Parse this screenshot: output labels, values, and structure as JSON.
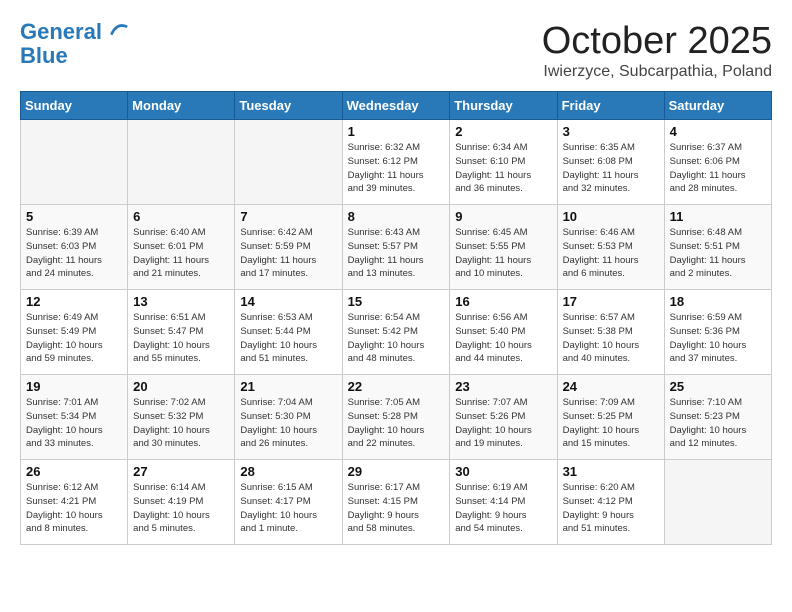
{
  "header": {
    "logo_line1": "General",
    "logo_line2": "Blue",
    "month": "October 2025",
    "location": "Iwierzyce, Subcarpathia, Poland"
  },
  "weekdays": [
    "Sunday",
    "Monday",
    "Tuesday",
    "Wednesday",
    "Thursday",
    "Friday",
    "Saturday"
  ],
  "weeks": [
    [
      {
        "day": "",
        "info": ""
      },
      {
        "day": "",
        "info": ""
      },
      {
        "day": "",
        "info": ""
      },
      {
        "day": "1",
        "info": "Sunrise: 6:32 AM\nSunset: 6:12 PM\nDaylight: 11 hours\nand 39 minutes."
      },
      {
        "day": "2",
        "info": "Sunrise: 6:34 AM\nSunset: 6:10 PM\nDaylight: 11 hours\nand 36 minutes."
      },
      {
        "day": "3",
        "info": "Sunrise: 6:35 AM\nSunset: 6:08 PM\nDaylight: 11 hours\nand 32 minutes."
      },
      {
        "day": "4",
        "info": "Sunrise: 6:37 AM\nSunset: 6:06 PM\nDaylight: 11 hours\nand 28 minutes."
      }
    ],
    [
      {
        "day": "5",
        "info": "Sunrise: 6:39 AM\nSunset: 6:03 PM\nDaylight: 11 hours\nand 24 minutes."
      },
      {
        "day": "6",
        "info": "Sunrise: 6:40 AM\nSunset: 6:01 PM\nDaylight: 11 hours\nand 21 minutes."
      },
      {
        "day": "7",
        "info": "Sunrise: 6:42 AM\nSunset: 5:59 PM\nDaylight: 11 hours\nand 17 minutes."
      },
      {
        "day": "8",
        "info": "Sunrise: 6:43 AM\nSunset: 5:57 PM\nDaylight: 11 hours\nand 13 minutes."
      },
      {
        "day": "9",
        "info": "Sunrise: 6:45 AM\nSunset: 5:55 PM\nDaylight: 11 hours\nand 10 minutes."
      },
      {
        "day": "10",
        "info": "Sunrise: 6:46 AM\nSunset: 5:53 PM\nDaylight: 11 hours\nand 6 minutes."
      },
      {
        "day": "11",
        "info": "Sunrise: 6:48 AM\nSunset: 5:51 PM\nDaylight: 11 hours\nand 2 minutes."
      }
    ],
    [
      {
        "day": "12",
        "info": "Sunrise: 6:49 AM\nSunset: 5:49 PM\nDaylight: 10 hours\nand 59 minutes."
      },
      {
        "day": "13",
        "info": "Sunrise: 6:51 AM\nSunset: 5:47 PM\nDaylight: 10 hours\nand 55 minutes."
      },
      {
        "day": "14",
        "info": "Sunrise: 6:53 AM\nSunset: 5:44 PM\nDaylight: 10 hours\nand 51 minutes."
      },
      {
        "day": "15",
        "info": "Sunrise: 6:54 AM\nSunset: 5:42 PM\nDaylight: 10 hours\nand 48 minutes."
      },
      {
        "day": "16",
        "info": "Sunrise: 6:56 AM\nSunset: 5:40 PM\nDaylight: 10 hours\nand 44 minutes."
      },
      {
        "day": "17",
        "info": "Sunrise: 6:57 AM\nSunset: 5:38 PM\nDaylight: 10 hours\nand 40 minutes."
      },
      {
        "day": "18",
        "info": "Sunrise: 6:59 AM\nSunset: 5:36 PM\nDaylight: 10 hours\nand 37 minutes."
      }
    ],
    [
      {
        "day": "19",
        "info": "Sunrise: 7:01 AM\nSunset: 5:34 PM\nDaylight: 10 hours\nand 33 minutes."
      },
      {
        "day": "20",
        "info": "Sunrise: 7:02 AM\nSunset: 5:32 PM\nDaylight: 10 hours\nand 30 minutes."
      },
      {
        "day": "21",
        "info": "Sunrise: 7:04 AM\nSunset: 5:30 PM\nDaylight: 10 hours\nand 26 minutes."
      },
      {
        "day": "22",
        "info": "Sunrise: 7:05 AM\nSunset: 5:28 PM\nDaylight: 10 hours\nand 22 minutes."
      },
      {
        "day": "23",
        "info": "Sunrise: 7:07 AM\nSunset: 5:26 PM\nDaylight: 10 hours\nand 19 minutes."
      },
      {
        "day": "24",
        "info": "Sunrise: 7:09 AM\nSunset: 5:25 PM\nDaylight: 10 hours\nand 15 minutes."
      },
      {
        "day": "25",
        "info": "Sunrise: 7:10 AM\nSunset: 5:23 PM\nDaylight: 10 hours\nand 12 minutes."
      }
    ],
    [
      {
        "day": "26",
        "info": "Sunrise: 6:12 AM\nSunset: 4:21 PM\nDaylight: 10 hours\nand 8 minutes."
      },
      {
        "day": "27",
        "info": "Sunrise: 6:14 AM\nSunset: 4:19 PM\nDaylight: 10 hours\nand 5 minutes."
      },
      {
        "day": "28",
        "info": "Sunrise: 6:15 AM\nSunset: 4:17 PM\nDaylight: 10 hours\nand 1 minute."
      },
      {
        "day": "29",
        "info": "Sunrise: 6:17 AM\nSunset: 4:15 PM\nDaylight: 9 hours\nand 58 minutes."
      },
      {
        "day": "30",
        "info": "Sunrise: 6:19 AM\nSunset: 4:14 PM\nDaylight: 9 hours\nand 54 minutes."
      },
      {
        "day": "31",
        "info": "Sunrise: 6:20 AM\nSunset: 4:12 PM\nDaylight: 9 hours\nand 51 minutes."
      },
      {
        "day": "",
        "info": ""
      }
    ]
  ]
}
